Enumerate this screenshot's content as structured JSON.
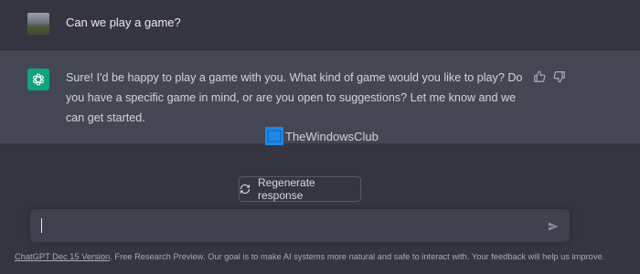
{
  "conversation": {
    "user_message": "Can we play a game?",
    "assistant_message": "Sure! I'd be happy to play a game with you. What kind of game would you like to play? Do you have a specific game in mind, or are you open to suggestions? Let me know and we can get started."
  },
  "watermark": {
    "text": "TheWindowsClub"
  },
  "actions": {
    "regenerate_label": "Regenerate response"
  },
  "composer": {
    "placeholder": ""
  },
  "footer": {
    "version_link": "ChatGPT Dec 15 Version",
    "disclaimer": ". Free Research Preview. Our goal is to make AI systems more natural and safe to interact with. Your feedback will help us improve."
  },
  "icons": {
    "user_avatar": "user-avatar-image",
    "assistant_avatar": "openai-logo-icon",
    "thumbs_up": "thumbs-up-icon",
    "thumbs_down": "thumbs-down-icon",
    "regenerate": "refresh-icon",
    "send": "send-icon",
    "watermark_logo": "windows-logo-icon"
  },
  "colors": {
    "background": "#343541",
    "assistant_bg": "#444654",
    "accent": "#10a37f"
  }
}
